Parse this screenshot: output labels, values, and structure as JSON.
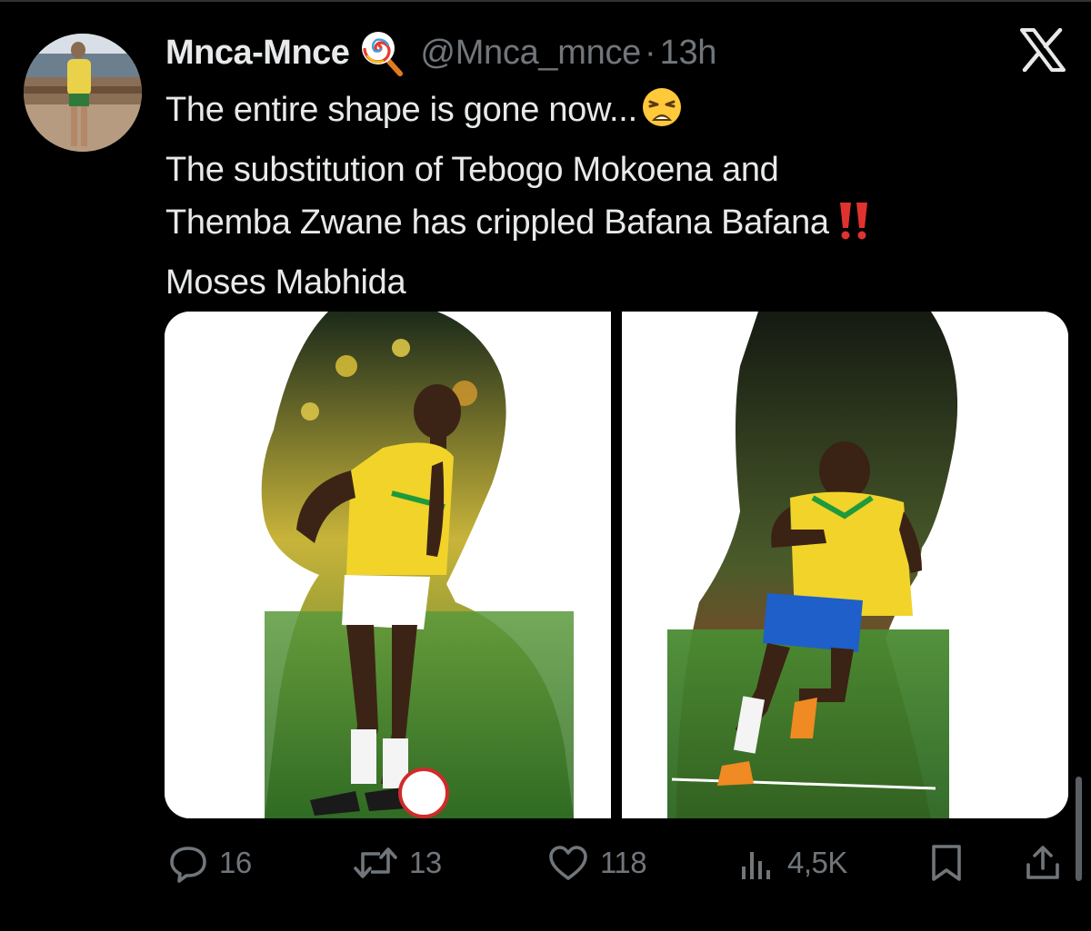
{
  "tweet": {
    "author": {
      "display_name": "Mnca-Mnce",
      "badge_icon": "lollipop-emoji",
      "handle": "@Mnca_mnce",
      "separator": "·",
      "time": "13h",
      "avatar_icon": "user-avatar-photo"
    },
    "text_lines": [
      "The entire shape is gone now...",
      "The substitution of Tebogo Mokoena and",
      "Themba Zwane has crippled Bafana Bafana",
      "Moses Mabhida"
    ],
    "emoji": {
      "line1": "weary-face-emoji",
      "line3": "double-exclamation-emoji"
    },
    "media": {
      "image_count": 2,
      "left_image": "player-silhouette-collage-yellow-kit-dribbling",
      "right_image": "player-silhouette-collage-yellow-kit-celebrating"
    },
    "actions": {
      "replies": "16",
      "reposts": "13",
      "likes": "118",
      "views": "4,5K"
    }
  },
  "colors": {
    "background": "#000000",
    "text_primary": "#e7e9ea",
    "text_secondary": "#71767b",
    "kit_yellow": "#f2d32a",
    "kit_green": "#1e9a3c",
    "kit_blue": "#1f5fc9",
    "pitch_green": "#3a7d2a",
    "alert_red": "#e0322e"
  },
  "icons": [
    "x-logo-icon",
    "reply-icon",
    "repost-icon",
    "like-icon",
    "views-icon",
    "bookmark-icon",
    "share-icon"
  ]
}
